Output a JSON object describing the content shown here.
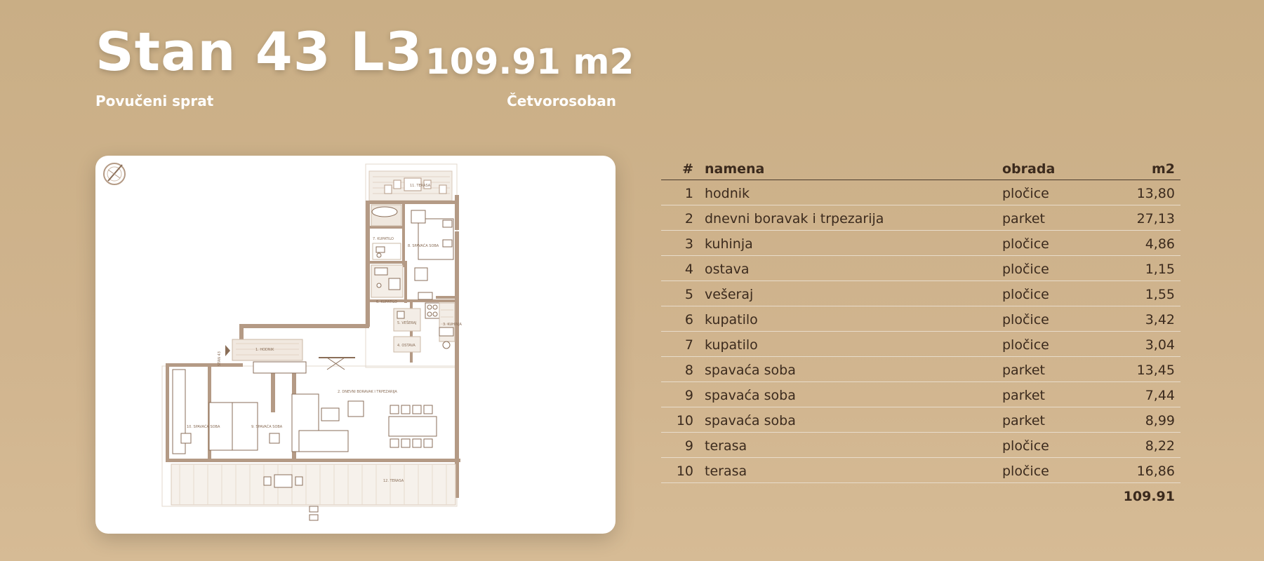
{
  "header": {
    "title": "Stan 43 L3",
    "area": "109.91 m2",
    "floor": "Povučeni sprat",
    "rooms": "Četvorosoban"
  },
  "plan": {
    "labels": {
      "r1": "1. HODNIK",
      "r2": "2. DNEVNI BORAVAK I TRPEZARIJA",
      "r3": "3. KUHINJA",
      "r4": "4. OSTAVA",
      "r5": "5. VEŠERAJ",
      "r6": "6. KUPATILO",
      "r7": "7. KUPATILO",
      "r8": "8. SPAVAĆA SOBA",
      "r9": "9. SPAVAĆA SOBA",
      "r10": "10. SPAVAĆA SOBA",
      "r11": "11. TERASA",
      "r12": "12. TERASA",
      "stan": "STAN 43"
    }
  },
  "table": {
    "headers": {
      "num": "#",
      "namena": "namena",
      "obrada": "obrada",
      "m2": "m2"
    },
    "rows": [
      {
        "num": "1",
        "namena": "hodnik",
        "obrada": "pločice",
        "m2": "13,80"
      },
      {
        "num": "2",
        "namena": "dnevni boravak i trpezarija",
        "obrada": "parket",
        "m2": "27,13"
      },
      {
        "num": "3",
        "namena": "kuhinja",
        "obrada": "pločice",
        "m2": "4,86"
      },
      {
        "num": "4",
        "namena": "ostava",
        "obrada": "pločice",
        "m2": "1,15"
      },
      {
        "num": "5",
        "namena": "vešeraj",
        "obrada": "pločice",
        "m2": "1,55"
      },
      {
        "num": "6",
        "namena": "kupatilo",
        "obrada": "pločice",
        "m2": "3,42"
      },
      {
        "num": "7",
        "namena": "kupatilo",
        "obrada": "pločice",
        "m2": "3,04"
      },
      {
        "num": "8",
        "namena": "spavaća soba",
        "obrada": "parket",
        "m2": "13,45"
      },
      {
        "num": "9",
        "namena": "spavaća soba",
        "obrada": "parket",
        "m2": "7,44"
      },
      {
        "num": "10",
        "namena": "spavaća soba",
        "obrada": "parket",
        "m2": "8,99"
      },
      {
        "num": "9",
        "namena": "terasa",
        "obrada": "pločice",
        "m2": "8,22"
      },
      {
        "num": "10",
        "namena": "terasa",
        "obrada": "pločice",
        "m2": "16,86"
      }
    ],
    "total": "109.91"
  },
  "colors": {
    "background": "#cdb189",
    "wall": "#b49a85",
    "text_dark": "#3b2a1d"
  }
}
